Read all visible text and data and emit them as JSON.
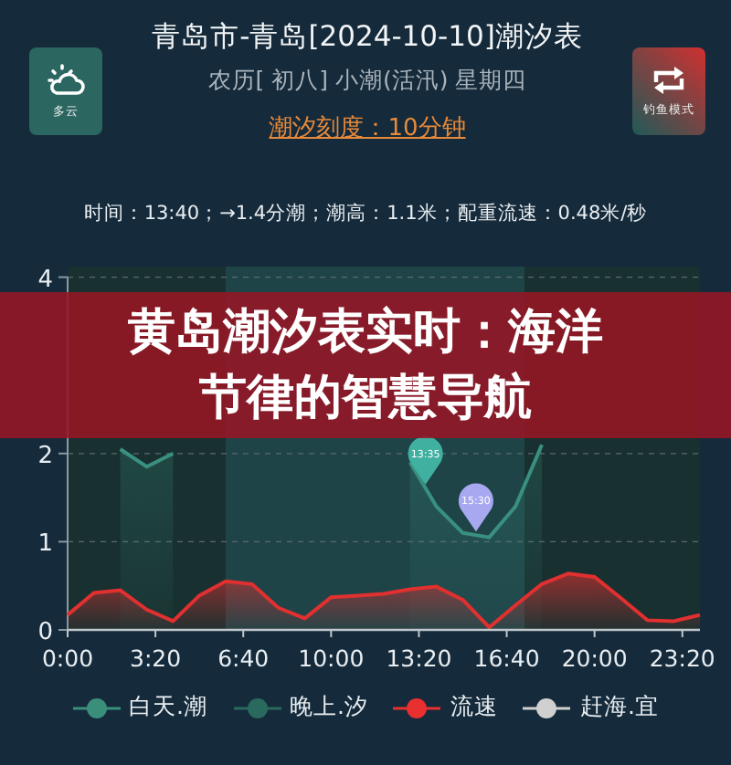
{
  "header": {
    "title": "青岛市-青岛[2024-10-10]潮汐表",
    "subtitle": "农历[ 初八] 小潮(活汛) 星期四",
    "scale_link": "潮汐刻度：10分钟"
  },
  "weather_tile": {
    "label": "多云"
  },
  "mode_tile": {
    "label": "钓鱼模式"
  },
  "info_line": "时间：13:40；→1.4分潮；潮高：1.1米；配重流速：0.48米/秒",
  "banner": {
    "lines": [
      "黄岛潮汐表实时：海洋",
      "节律的智慧导航"
    ]
  },
  "chart": {
    "chart_data": {
      "type": "area",
      "xlim": [
        0,
        1440
      ],
      "ylim": [
        0,
        4
      ],
      "grid": true,
      "x": [
        0,
        60,
        120,
        180,
        240,
        300,
        360,
        420,
        480,
        540,
        600,
        660,
        720,
        780,
        840,
        900,
        960,
        1020,
        1080,
        1140,
        1200,
        1260,
        1320,
        1380,
        1440
      ],
      "xticks": [
        {
          "value": 0,
          "label": "0:00"
        },
        {
          "value": 200,
          "label": "3:20"
        },
        {
          "value": 400,
          "label": "6:40"
        },
        {
          "value": 600,
          "label": "10:00"
        },
        {
          "value": 800,
          "label": "13:20"
        },
        {
          "value": 1000,
          "label": "16:40"
        },
        {
          "value": 1200,
          "label": "20:00"
        },
        {
          "value": 1400,
          "label": "23:20"
        }
      ],
      "yticks": [
        0,
        1,
        2,
        4
      ],
      "series": [
        {
          "color": "#3a9080",
          "values": [
            null,
            null,
            2.05,
            1.85,
            2.0,
            null,
            null,
            null,
            null,
            null,
            null,
            null,
            null,
            1.9,
            1.4,
            1.1,
            1.05,
            1.4,
            2.1,
            null,
            null,
            null,
            null,
            null,
            null
          ]
        },
        {
          "color": "#e03030",
          "values": [
            0.17,
            0.42,
            0.45,
            0.23,
            0.1,
            0.39,
            0.55,
            0.52,
            0.25,
            0.13,
            0.37,
            0.39,
            0.41,
            0.46,
            0.49,
            0.34,
            0.03,
            0.28,
            0.52,
            0.64,
            0.6,
            0.36,
            0.11,
            0.1,
            0.17
          ]
        }
      ]
    },
    "markers": [
      {
        "label": "13:35",
        "color": "#40b0a0"
      },
      {
        "label": "15:30",
        "color": "#a8a8f0"
      }
    ]
  },
  "legend": [
    {
      "label": "白天.潮",
      "color": "#3a8f7a"
    },
    {
      "label": "晚上.汐",
      "color": "#2a6a5e"
    },
    {
      "label": "流速",
      "color": "#e83030"
    },
    {
      "label": "赶海.宜",
      "color": "#d0d0d0"
    }
  ]
}
